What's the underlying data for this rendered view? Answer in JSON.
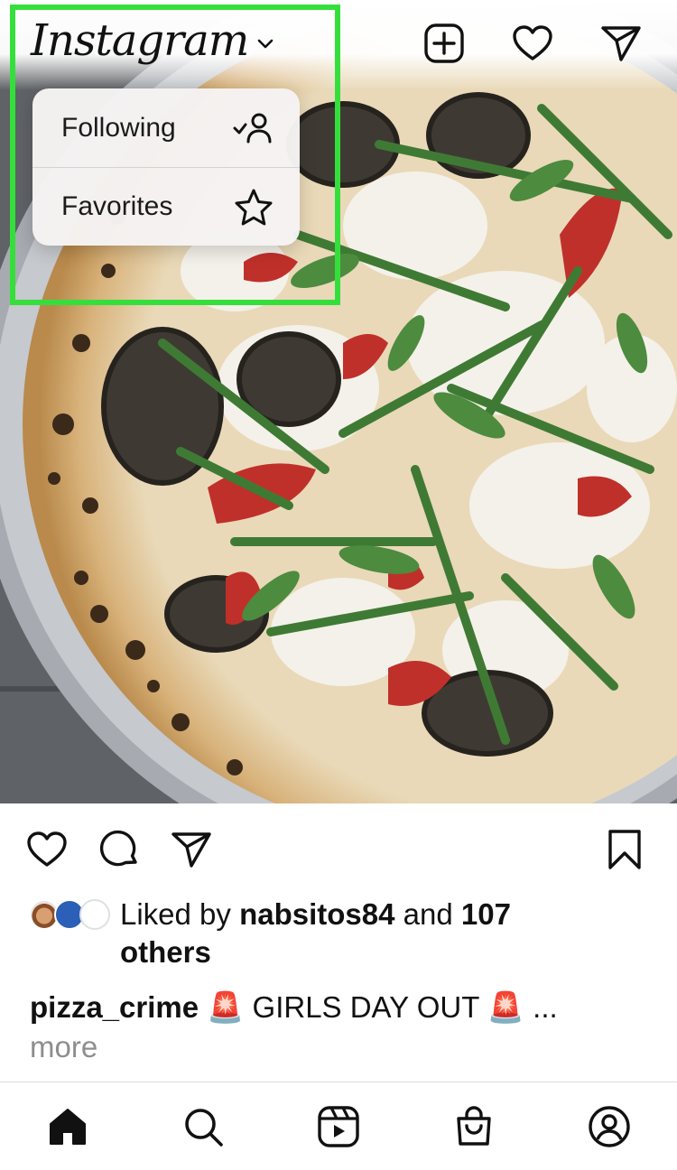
{
  "header": {
    "logo_text": "Instagram",
    "icons": [
      "chevron-down-icon",
      "new-post-icon",
      "heart-icon",
      "direct-message-icon"
    ]
  },
  "feed_menu": {
    "items": [
      {
        "label": "Following",
        "icon": "following-icon"
      },
      {
        "label": "Favorites",
        "icon": "star-icon"
      }
    ]
  },
  "post": {
    "image_description_icon": "pizza-photo",
    "actions": [
      "heart-icon",
      "comment-icon",
      "share-icon",
      "bookmark-icon"
    ],
    "likes": {
      "prefix": "Liked by ",
      "user": "nabsitos84",
      "middle": " and ",
      "count": "107",
      "suffix": "others"
    },
    "caption": {
      "username": "pizza_crime",
      "text": " 🚨 GIRLS DAY OUT 🚨 ...",
      "more": "more"
    }
  },
  "bottom_nav": {
    "items": [
      "home-icon",
      "search-icon",
      "reels-icon",
      "shop-icon",
      "profile-icon"
    ]
  },
  "colors": {
    "highlight": "#35df3b",
    "muted_text": "#8e8e8e"
  }
}
